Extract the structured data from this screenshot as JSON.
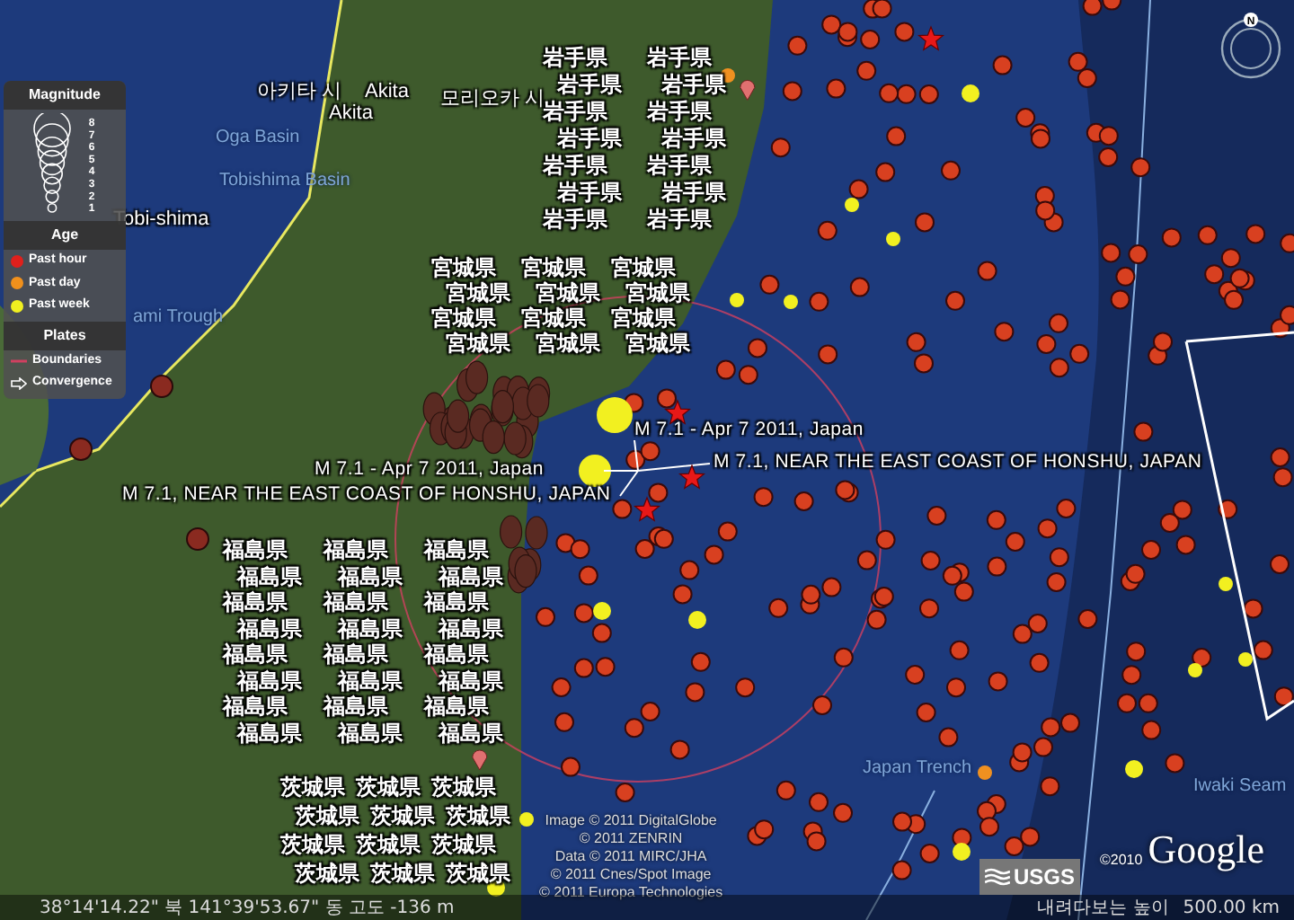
{
  "map": {
    "place_labels": [
      {
        "text": "아키타 시",
        "kind": "city"
      },
      {
        "text": "Akita",
        "kind": "city"
      },
      {
        "text": "Akita",
        "kind": "city"
      },
      {
        "text": "모리오카 시",
        "kind": "city"
      },
      {
        "text": "Oga Basin",
        "kind": "feature"
      },
      {
        "text": "Tobishima Basin",
        "kind": "feature"
      },
      {
        "text": "Tobi-shima",
        "kind": "city"
      },
      {
        "text": "ami Trough",
        "kind": "feature"
      },
      {
        "text": "Japan Trench",
        "kind": "feature"
      },
      {
        "text": "Iwaki Seam",
        "kind": "feature"
      }
    ],
    "prefecture_groups": [
      {
        "labels": [
          "岩手県",
          "岩手県",
          "岩手県",
          "岩手県",
          "岩手県",
          "岩手県",
          "岩手県",
          "岩手県",
          "岩手県",
          "岩手県",
          "岩手県",
          "岩手県",
          "岩手県",
          "岩手県"
        ]
      },
      {
        "labels": [
          "宮城県",
          "宮城県",
          "宮城県",
          "宮城県",
          "宮城県",
          "宮城県",
          "宮城県",
          "宮城県",
          "宮城県",
          "宮城県",
          "宮城県",
          "宮城県"
        ]
      },
      {
        "labels": [
          "福島県",
          "福島県",
          "福島県",
          "福島県",
          "福島県",
          "福島県",
          "福島県",
          "福島県",
          "福島県",
          "福島県",
          "福島県",
          "福島県",
          "福島県",
          "福島県",
          "福島県",
          "福島県",
          "福島県",
          "福島県",
          "福島県",
          "福島県",
          "福島県",
          "福島県",
          "福島県",
          "福島県"
        ]
      },
      {
        "labels": [
          "茨城県",
          "茨城県",
          "茨城県",
          "茨城県",
          "茨城県",
          "茨城県",
          "茨城県",
          "茨城県",
          "茨城県",
          "茨城県",
          "茨城県",
          "茨城県"
        ]
      }
    ],
    "quake_labels": [
      "M 7.1 - Apr 7 2011, Japan",
      "M 7.1 - Apr 7 2011, Japan",
      "M 7.1, NEAR THE EAST COAST OF HONSHU, JAPAN",
      "M 7.1, NEAR THE EAST COAST OF HONSHU, JAPAN"
    ]
  },
  "legend": {
    "magnitude_title": "Magnitude",
    "magnitude_scale": [
      "8",
      "7",
      "6",
      "5",
      "4",
      "3",
      "2",
      "1"
    ],
    "age_title": "Age",
    "ages": [
      {
        "label": "Past hour",
        "color": "#e0201c"
      },
      {
        "label": "Past day",
        "color": "#f0901c"
      },
      {
        "label": "Past week",
        "color": "#f0f020"
      }
    ],
    "plates_title": "Plates",
    "plates": [
      {
        "label": "Boundaries",
        "kind": "line"
      },
      {
        "label": "Convergence",
        "kind": "arrow"
      }
    ]
  },
  "compass": {
    "label": "N"
  },
  "attribution": [
    "Image © 2011 DigitalGlobe",
    "© 2011 ZENRIN",
    "Data © 2011 MIRC/JHA",
    "© 2011 Cnes/Spot Image",
    "© 2011 Europa Technologies"
  ],
  "logo": {
    "copyright": "©2010",
    "text": "Google"
  },
  "usgs": {
    "text": "USGS"
  },
  "status_bar": {
    "coordinates": "38°14'14.22\" 북 141°39'53.67\" 동 고도 -136 m",
    "eye_altitude_label": "내려다보는 높이",
    "eye_altitude_value": "500.00 km"
  }
}
